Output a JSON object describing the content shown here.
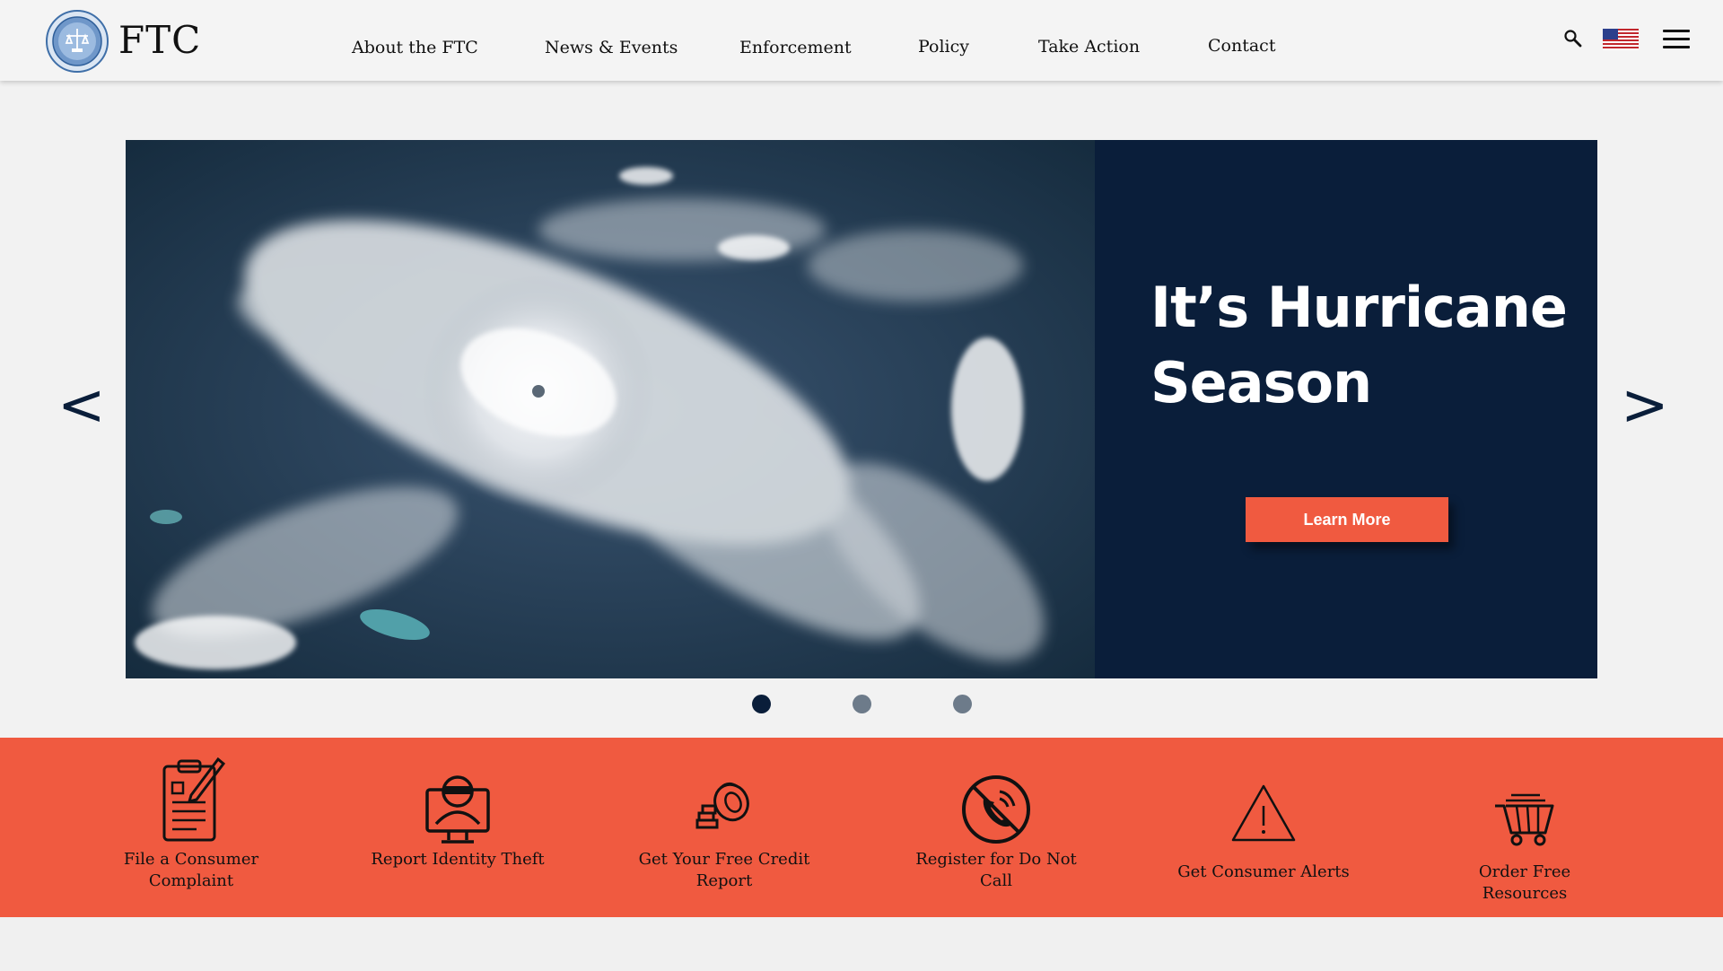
{
  "header": {
    "brand": "FTC",
    "nav": [
      {
        "label": "About the FTC"
      },
      {
        "label": "News & Events"
      },
      {
        "label": "Enforcement"
      },
      {
        "label": "Policy"
      },
      {
        "label": "Take Action"
      },
      {
        "label": "Contact"
      }
    ],
    "icons": [
      "ftc-seal-logo",
      "search-icon",
      "us-flag-icon",
      "hamburger-menu-icon"
    ]
  },
  "hero": {
    "title": "It’s Hurricane Season",
    "button_label": "Learn More",
    "prev_arrow": "<",
    "next_arrow": ">",
    "slides_total": 3,
    "active_slide": 1,
    "panel_color": "#0a1e3a",
    "button_color": "#f05a40"
  },
  "actions": [
    {
      "label": "File a Consumer Complaint",
      "icon": "complaint-clipboard-icon"
    },
    {
      "label": "Report Identity Theft",
      "icon": "identity-thief-icon"
    },
    {
      "label": "Get Your Free Credit Report",
      "icon": "credit-report-icon"
    },
    {
      "label": "Register for Do Not Call",
      "icon": "do-not-call-icon"
    },
    {
      "label": "Get Consumer Alerts",
      "icon": "alert-triangle-icon"
    },
    {
      "label": "Order Free Resources",
      "icon": "shopping-cart-icon"
    }
  ],
  "colors": {
    "accent": "#f05a40",
    "navy": "#0a1e3a",
    "background": "#f2f2f2"
  }
}
